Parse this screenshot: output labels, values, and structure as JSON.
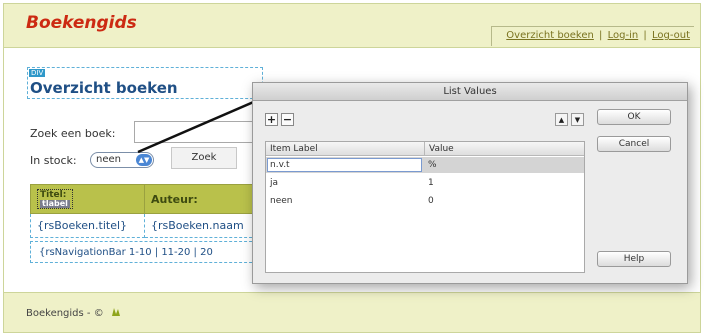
{
  "header": {
    "brand": "Boekengids",
    "nav": [
      "Overzicht boeken",
      "Log-in",
      "Log-out"
    ],
    "nav_separator": "|"
  },
  "main": {
    "div_tag": "DIV",
    "page_title": "Overzicht boeken",
    "search_label": "Zoek een boek:",
    "stock_label": "In stock:",
    "stock_selected": "neen",
    "search_button": "Zoek",
    "table": {
      "header_title": "Titel:",
      "header_title_tag": "tlabel",
      "header_author": "Auteur:",
      "row_title": "{rsBoeken.titel}",
      "row_author": "{rsBoeken.naam"
    },
    "navigation_bar": "{rsNavigationBar 1-10 | 11-20 | 20"
  },
  "dialog": {
    "title": "List Values",
    "add_label": "+",
    "remove_label": "−",
    "column_label": "Item Label",
    "column_value": "Value",
    "rows": [
      {
        "label": "n.v.t",
        "value": "%"
      },
      {
        "label": "ja",
        "value": "1"
      },
      {
        "label": "neen",
        "value": "0"
      }
    ],
    "ok_label": "OK",
    "cancel_label": "Cancel",
    "help_label": "Help"
  },
  "footer": {
    "text": "Boekengids - ©"
  },
  "colors": {
    "brand": "#cc2a12",
    "header_bg": "#eff1c8",
    "title_blue": "#1f4f85",
    "table_header": "#b9c14b"
  }
}
